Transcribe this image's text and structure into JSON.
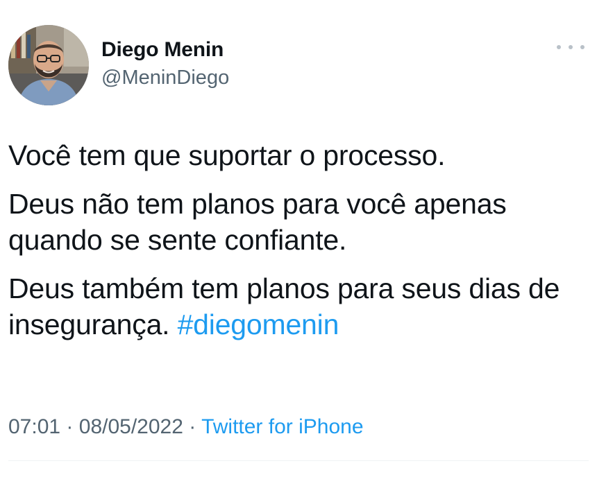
{
  "author": {
    "display_name": "Diego Menin",
    "handle": "@MeninDiego",
    "avatar_icon": "profile-photo"
  },
  "more_icon": "more-horizontal-icon",
  "tweet": {
    "line1": "Você tem que suportar o processo.",
    "line2": "Deus não tem planos para você apenas quando se sente confiante.",
    "line3_text": "Deus também tem planos para seus dias de insegurança.",
    "hashtag": "#diegomenin"
  },
  "meta": {
    "time": "07:01",
    "separator1": "·",
    "date": "08/05/2022",
    "separator2": "·",
    "source": "Twitter for iPhone"
  },
  "colors": {
    "text": "#0f1419",
    "secondary": "#536471",
    "link": "#1d9bf0"
  }
}
